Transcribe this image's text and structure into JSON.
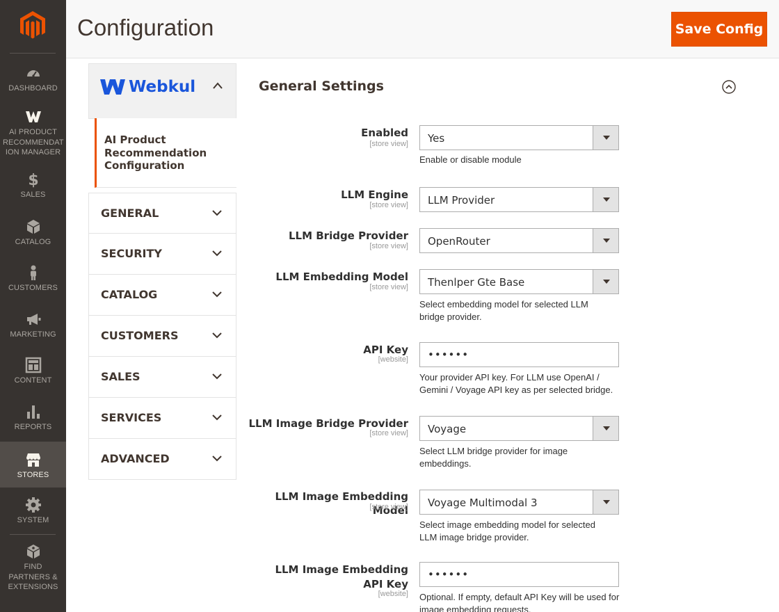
{
  "nav": {
    "items": [
      {
        "label": "DASHBOARD",
        "icon": "dashboard-icon"
      },
      {
        "label": "AI PRODUCT RECOMMENDAT ION MANAGER",
        "icon": "webkul-w-icon"
      },
      {
        "label": "SALES",
        "icon": "dollar-icon"
      },
      {
        "label": "CATALOG",
        "icon": "cube-icon"
      },
      {
        "label": "CUSTOMERS",
        "icon": "person-icon"
      },
      {
        "label": "MARKETING",
        "icon": "megaphone-icon"
      },
      {
        "label": "CONTENT",
        "icon": "layout-icon"
      },
      {
        "label": "REPORTS",
        "icon": "bar-chart-icon"
      },
      {
        "label": "STORES",
        "icon": "store-icon"
      },
      {
        "label": "SYSTEM",
        "icon": "gear-icon"
      },
      {
        "label": "FIND PARTNERS & EXTENSIONS",
        "icon": "box-icon"
      }
    ],
    "active": "STORES"
  },
  "header": {
    "title": "Configuration",
    "save_label": "Save Config"
  },
  "tabs": {
    "brand": "Webkul",
    "sub_item": "AI Product Recommendation Configuration",
    "items": [
      "GENERAL",
      "SECURITY",
      "CATALOG",
      "CUSTOMERS",
      "SALES",
      "SERVICES",
      "ADVANCED"
    ]
  },
  "section": {
    "title": "General Settings",
    "fields": [
      {
        "label": "Enabled",
        "scope": "[store view]",
        "value": "Yes",
        "note": "Enable or disable module"
      },
      {
        "label": "LLM Engine",
        "scope": "[store view]",
        "value": "LLM Provider",
        "note": ""
      },
      {
        "label": "LLM Bridge Provider",
        "scope": "[store view]",
        "value": "OpenRouter",
        "note": ""
      },
      {
        "label": "LLM Embedding Model",
        "scope": "[store view]",
        "value": "Thenlper Gte Base",
        "note": "Select embedding model for selected LLM bridge provider."
      },
      {
        "label": "API Key",
        "scope": "[website]",
        "value": "••••••",
        "note": "Your provider API key. For LLM use OpenAI / Gemini / Voyage API key as per selected bridge."
      },
      {
        "label": "LLM Image Bridge Provider",
        "scope": "[store view]",
        "value": "Voyage",
        "note": "Select LLM bridge provider for image embeddings."
      },
      {
        "label": "LLM Image Embedding Model",
        "scope": "[store view]",
        "value": "Voyage Multimodal 3",
        "note": "Select image embedding model for selected LLM image bridge provider."
      },
      {
        "label": "LLM Image Embedding API Key",
        "scope": "[website]",
        "value": "••••••",
        "note": "Optional. If empty, default API Key will be used for image embedding requests."
      }
    ]
  }
}
